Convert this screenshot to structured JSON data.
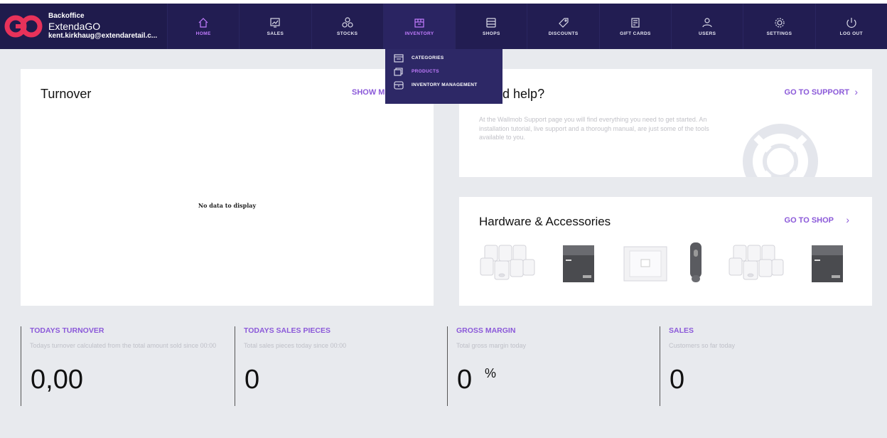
{
  "header": {
    "brand_line1": "Backoffice",
    "brand_line2": "ExtendaGO",
    "brand_line3": "kent.kirkhaug@extendaretail.c...",
    "nav": [
      {
        "label": "HOME",
        "icon": "home-icon"
      },
      {
        "label": "SALES",
        "icon": "chart-icon"
      },
      {
        "label": "STOCKS",
        "icon": "boxes-icon"
      },
      {
        "label": "INVENTORY",
        "icon": "package-icon"
      },
      {
        "label": "SHOPS",
        "icon": "shop-icon"
      },
      {
        "label": "DISCOUNTS",
        "icon": "tag-icon"
      },
      {
        "label": "GIFT CARDS",
        "icon": "gift-card-icon"
      },
      {
        "label": "USERS",
        "icon": "users-icon"
      },
      {
        "label": "SETTINGS",
        "icon": "gear-icon"
      },
      {
        "label": "LOG OUT",
        "icon": "power-icon"
      }
    ]
  },
  "inventory_menu": [
    {
      "label": "CATEGORIES",
      "icon": "categories-icon"
    },
    {
      "label": "PRODUCTS",
      "icon": "products-icon"
    },
    {
      "label": "INVENTORY MANAGEMENT",
      "icon": "inventory-management-icon"
    }
  ],
  "turnover": {
    "title": "Turnover",
    "show_more": "SHOW MO",
    "empty_text": "No data to display"
  },
  "help": {
    "title": "Need help?",
    "link": "GO TO SUPPORT",
    "description": "At the Wallmob Support page you will find everything you need to get started. An installation tutorial, live support and a thorough manual, are just some of the tools available to you."
  },
  "hardware": {
    "title": "Hardware & Accessories",
    "link": "GO TO SHOP"
  },
  "stats": [
    {
      "heading": "TODAYS TURNOVER",
      "description": "Todays turnover calculated from the total amount sold since 00:00",
      "value": "0,00"
    },
    {
      "heading": "TODAYS SALES PIECES",
      "description": "Total sales pieces today since 00:00",
      "value": "0"
    },
    {
      "heading": "GROSS MARGIN",
      "description": "Total gross margin today",
      "value": "0",
      "unit": "%"
    },
    {
      "heading": "SALES",
      "description": "Customers so far today",
      "value": "0"
    }
  ],
  "colors": {
    "nav_bg": "#1f1b4c",
    "accent": "#8b59d9",
    "active_nav": "#c27cff",
    "page_bg": "#e8eaee"
  }
}
